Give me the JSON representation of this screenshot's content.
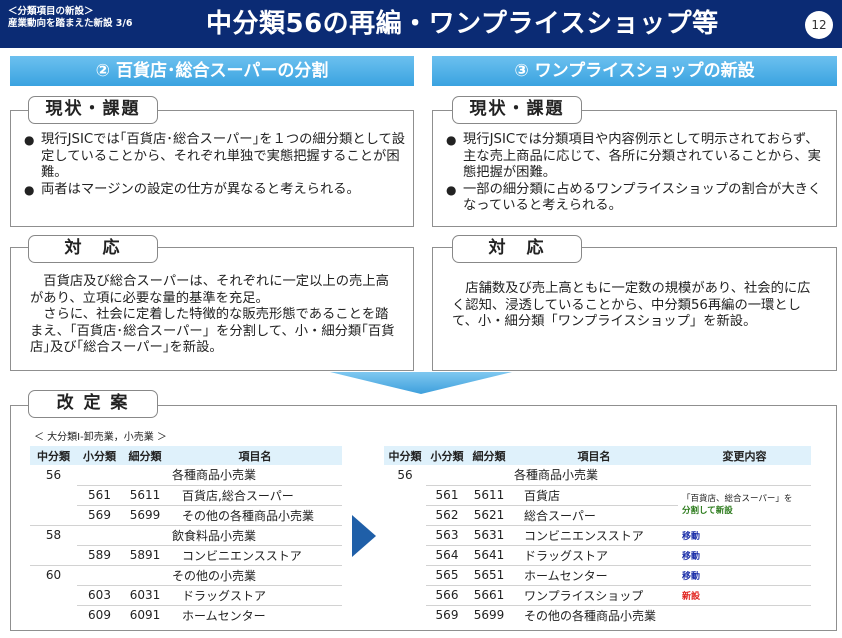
{
  "header": {
    "sub_line1": "＜分類項目の新設＞",
    "sub_line2": "産業動向を踏まえた新設 3/6",
    "title": "中分類56の再編・ワンプライスショップ等",
    "page_number": "12"
  },
  "left": {
    "banner": "② 百貨店･総合スーパーの分割",
    "status_tag": "現状・課題",
    "status_bullets": [
      "現行JSICでは｢百貨店･総合スーパー｣を１つの細分類として設定していることから、それぞれ単独で実態把握することが困難。",
      "両者はマージンの設定の仕方が異なると考えられる。"
    ],
    "response_tag": "対　応",
    "response_paras": [
      "百貨店及び総合スーパーは、それぞれに一定以上の売上高があり、立項に必要な量的基準を充足。",
      "さらに、社会に定着した特徴的な販売形態であることを踏まえ、「百貨店･総合スーパー」を分割して、小・細分類｢百貨店｣及び｢総合スーパー｣を新設。"
    ]
  },
  "right": {
    "banner": "③ ワンプライスショップの新設",
    "status_tag": "現状・課題",
    "status_bullets": [
      "現行JSICでは分類項目や内容例示として明示されておらず、主な売上商品に応じて、各所に分類されていることから、実態把握が困難。",
      "一部の細分類に占めるワンプライスショップの割合が大きくなっていると考えられる。"
    ],
    "response_tag": "対　応",
    "response_paras": [
      "店舗数及び売上高ともに一定数の規模があり、社会的に広く認知、浸透していることから、中分類56再編の一環として、小・細分類「ワンプライスショップ」を新設。"
    ]
  },
  "revision": {
    "tag": "改 定 案",
    "caption": "＜ 大分類I-卸売業，小売業 ＞",
    "old_headers": [
      "中分類",
      "小分類",
      "細分類",
      "項目名"
    ],
    "old_rows": [
      {
        "mid": "56",
        "small": "",
        "fine": "",
        "name": "各種商品小売業"
      },
      {
        "mid": "",
        "small": "561",
        "fine": "5611",
        "name": "百貨店,総合スーパー"
      },
      {
        "mid": "",
        "small": "569",
        "fine": "5699",
        "name": "その他の各種商品小売業"
      },
      {
        "mid": "58",
        "small": "",
        "fine": "",
        "name": "飲食料品小売業"
      },
      {
        "mid": "",
        "small": "589",
        "fine": "5891",
        "name": "コンビニエンスストア"
      },
      {
        "mid": "60",
        "small": "",
        "fine": "",
        "name": "その他の小売業"
      },
      {
        "mid": "",
        "small": "603",
        "fine": "6031",
        "name": "ドラッグストア"
      },
      {
        "mid": "",
        "small": "609",
        "fine": "6091",
        "name": "ホームセンター"
      }
    ],
    "new_headers": [
      "中分類",
      "小分類",
      "細分類",
      "項目名",
      "変更内容"
    ],
    "new_rows": [
      {
        "mid": "56",
        "small": "",
        "fine": "",
        "name": "各種商品小売業",
        "change": ""
      },
      {
        "mid": "",
        "small": "561",
        "fine": "5611",
        "name": "百貨店",
        "change": ""
      },
      {
        "mid": "",
        "small": "562",
        "fine": "5621",
        "name": "総合スーパー",
        "change": ""
      },
      {
        "mid": "",
        "small": "563",
        "fine": "5631",
        "name": "コンビニエンスストア",
        "change": "移動"
      },
      {
        "mid": "",
        "small": "564",
        "fine": "5641",
        "name": "ドラッグストア",
        "change": "移動"
      },
      {
        "mid": "",
        "small": "565",
        "fine": "5651",
        "name": "ホームセンター",
        "change": "移動"
      },
      {
        "mid": "",
        "small": "566",
        "fine": "5661",
        "name": "ワンプライスショップ",
        "change": "新設"
      },
      {
        "mid": "",
        "small": "569",
        "fine": "5699",
        "name": "その他の各種商品小売業",
        "change": ""
      }
    ],
    "split_note_line1": "「百貨店、総合スーパー」を",
    "split_note_line2": "分割して新設"
  },
  "colors": {
    "header_bg": "#0b2b74",
    "banner": "#3aa3e0",
    "table_header": "#dff1fb",
    "move": "#1a2ea8",
    "new": "#e0201b",
    "split": "#2a7a1a"
  }
}
